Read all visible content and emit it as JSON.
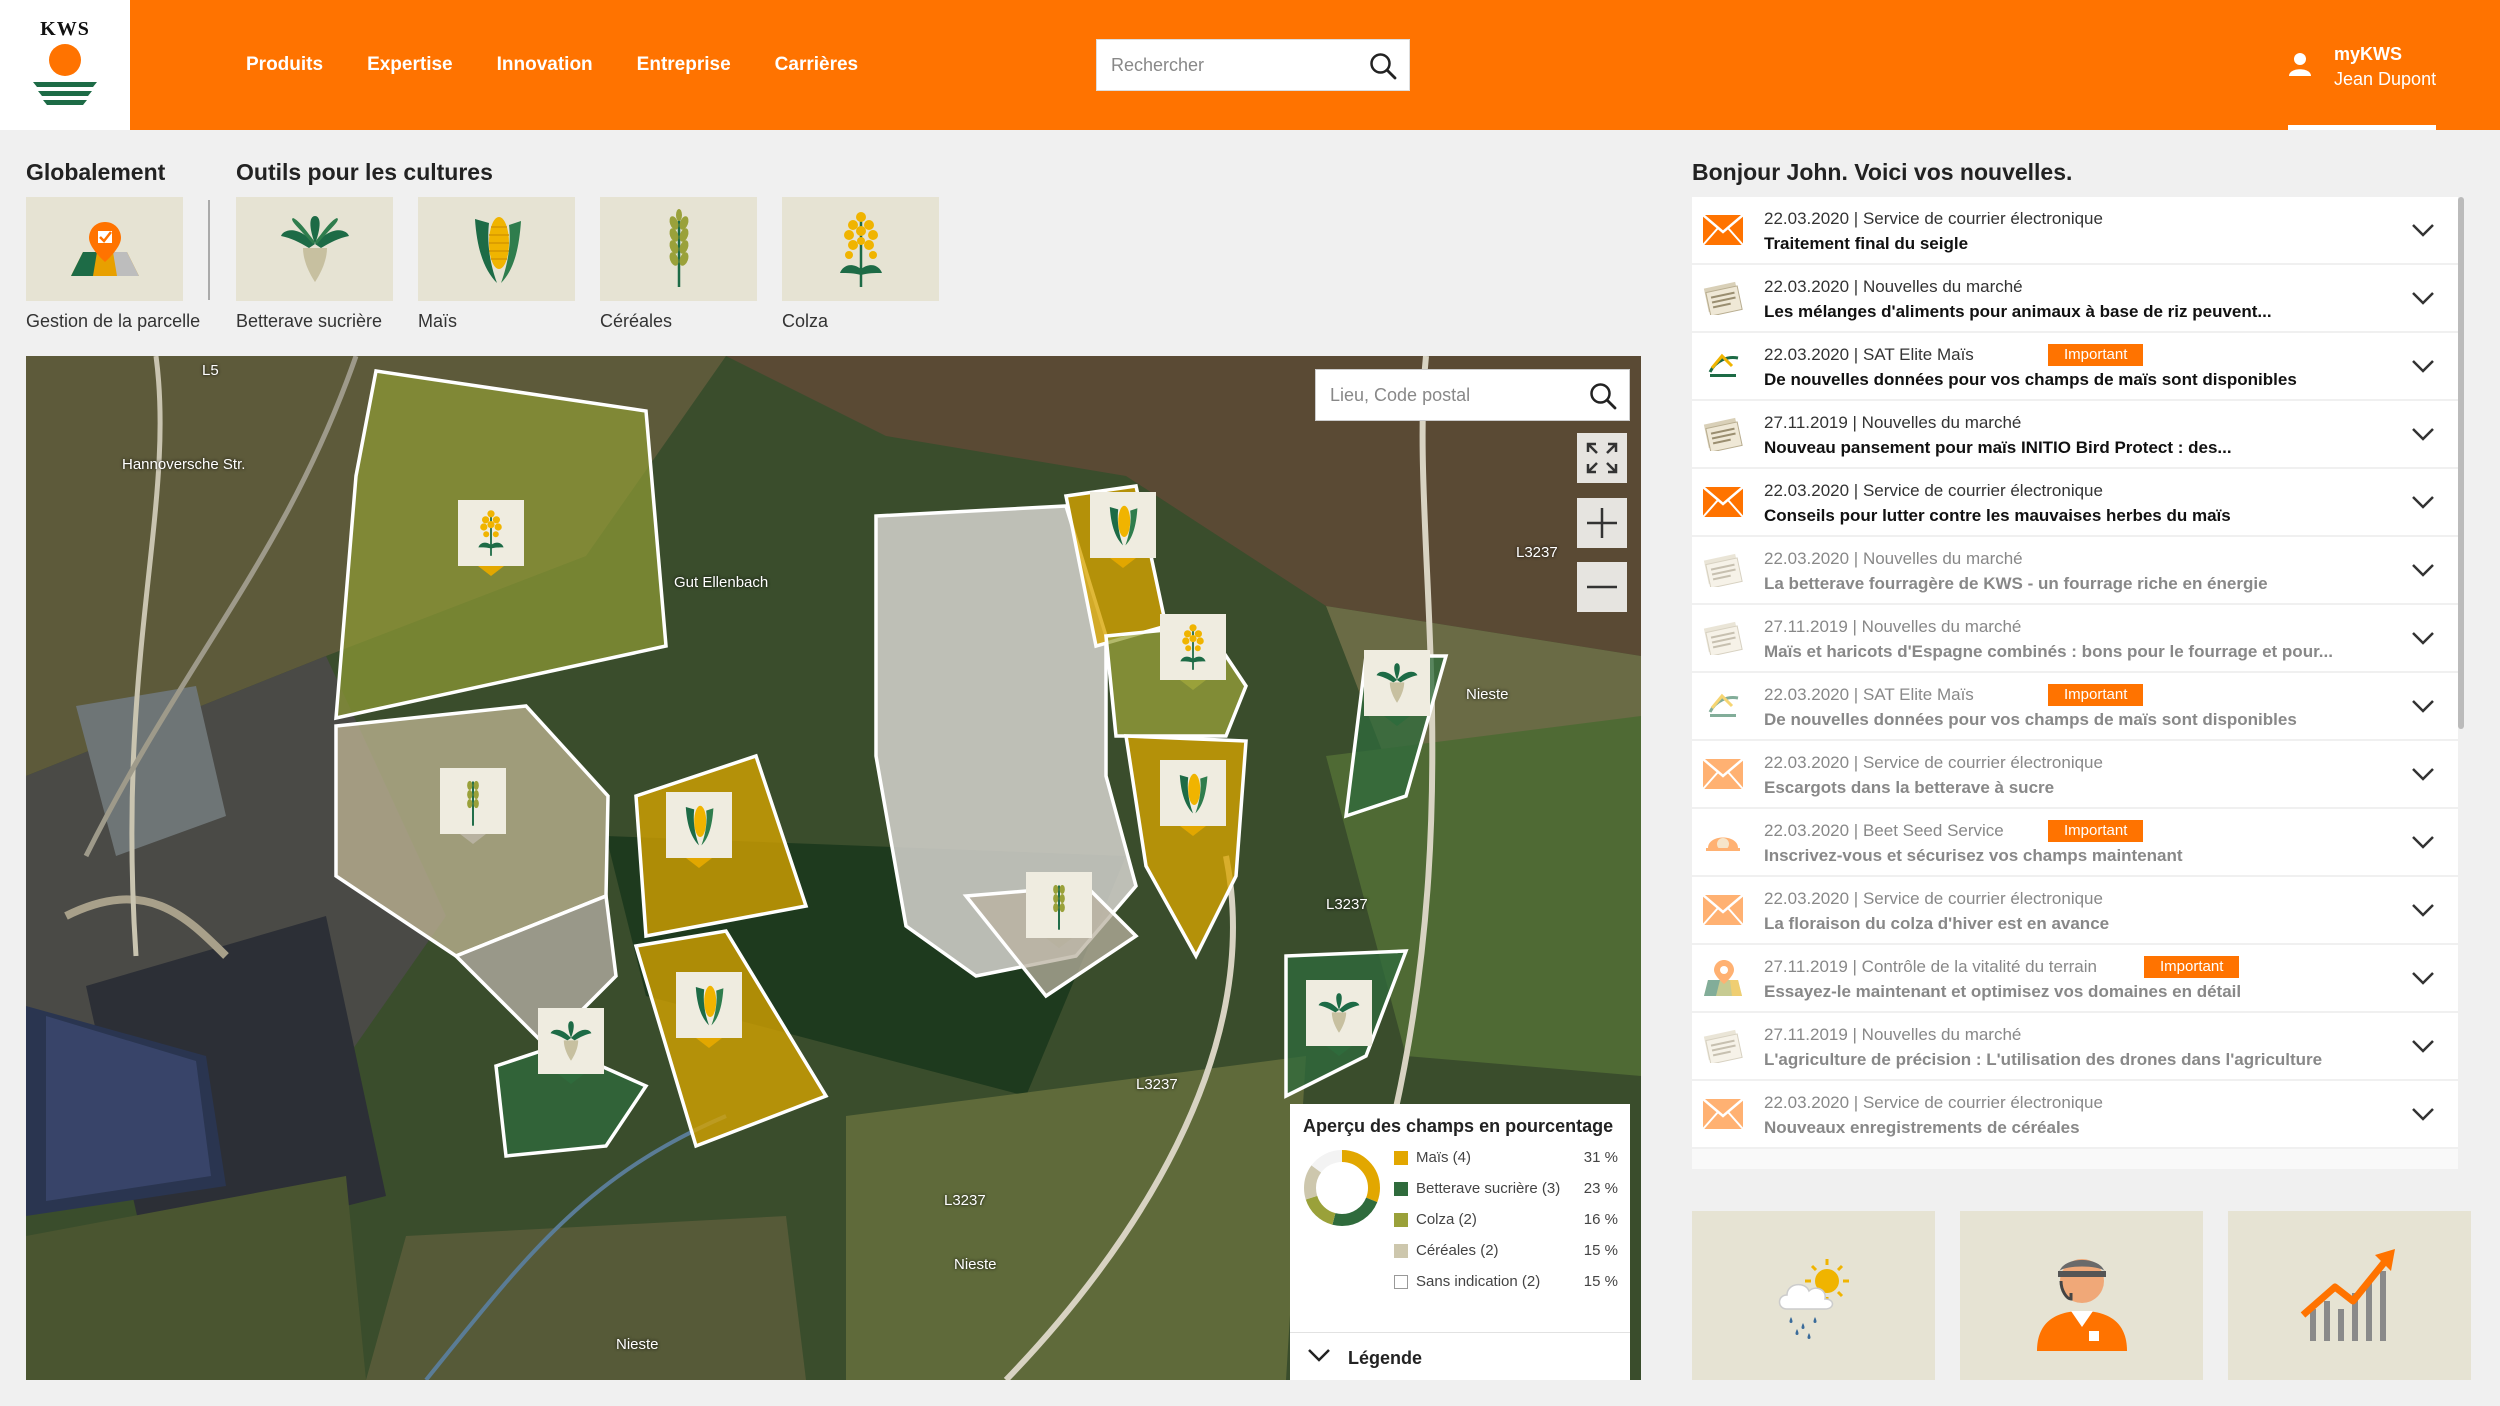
{
  "brand": {
    "logo_text": "KWS",
    "accent": "#ff7300"
  },
  "nav": {
    "items": [
      "Produits",
      "Expertise",
      "Innovation",
      "Entreprise",
      "Carrières"
    ]
  },
  "search": {
    "placeholder": "Rechercher",
    "icon": "search-icon"
  },
  "user": {
    "label": "myKWS",
    "name": "Jean Dupont",
    "icon": "user-icon"
  },
  "sections": {
    "overall": "Globalement",
    "crop_tools": "Outils pour les cultures",
    "news_greeting": "Bonjour John. Voici vos nouvelles."
  },
  "tools": [
    {
      "label": "Gestion de la parcelle",
      "icon": "field-map-pin-icon"
    },
    {
      "label": "Betterave sucrière",
      "icon": "sugar-beet-icon"
    },
    {
      "label": "Maïs",
      "icon": "corn-icon"
    },
    {
      "label": "Céréales",
      "icon": "wheat-icon"
    },
    {
      "label": "Colza",
      "icon": "rapeseed-icon"
    }
  ],
  "map": {
    "search_placeholder": "Lieu, Code postal",
    "place_label": "Gut Ellenbach",
    "road_labels": [
      "L3237",
      "L3237",
      "L3237",
      "L3237",
      "Nieste",
      "Nieste",
      "Nieste",
      "Hannoversche Str.",
      "L5"
    ],
    "controls": {
      "fullscreen": "fullscreen-icon",
      "zoom_in": "plus-icon",
      "zoom_out": "minus-icon"
    }
  },
  "legend": {
    "title": "Aperçu des champs en pourcentage",
    "items": [
      {
        "name": "Maïs (4)",
        "percent": "31 %",
        "color": "#e2a700",
        "share": 31
      },
      {
        "name": "Betterave sucrière (3)",
        "percent": "23 %",
        "color": "#2f6b3c",
        "share": 23
      },
      {
        "name": "Colza (2)",
        "percent": "16 %",
        "color": "#9aa13a",
        "share": 16
      },
      {
        "name": "Céréales (2)",
        "percent": "15 %",
        "color": "#cdc7ad",
        "share": 15
      },
      {
        "name": "Sans indication (2)",
        "percent": "15 %",
        "color": "#ffffff",
        "share": 15
      }
    ],
    "footer": "Légende"
  },
  "news": [
    {
      "meta": "22.03.2020 | Service de courrier électronique",
      "title": "Traitement final du seigle",
      "icon": "envelope-icon",
      "badge": "",
      "faded": false
    },
    {
      "meta": "22.03.2020 | Nouvelles du marché",
      "title": "Les mélanges d'aliments pour animaux à base de riz peuvent...",
      "icon": "newspaper-icon",
      "badge": "",
      "faded": false
    },
    {
      "meta": "22.03.2020 | SAT Elite Maïs",
      "title": "De nouvelles données pour vos champs de maïs sont disponibles",
      "icon": "sat-elite-icon",
      "badge": "Important",
      "faded": false
    },
    {
      "meta": "27.11.2019 | Nouvelles du marché",
      "title": "Nouveau pansement pour maïs INITIO Bird Protect : des...",
      "icon": "newspaper-icon",
      "badge": "",
      "faded": false
    },
    {
      "meta": "22.03.2020 | Service de courrier électronique",
      "title": "Conseils pour lutter contre les mauvaises herbes du maïs",
      "icon": "envelope-icon",
      "badge": "",
      "faded": false
    },
    {
      "meta": "22.03.2020 | Nouvelles du marché",
      "title": "La betterave fourragère de KWS - un fourrage riche en énergie",
      "icon": "newspaper-icon",
      "badge": "",
      "faded": true
    },
    {
      "meta": "27.11.2019 | Nouvelles du marché",
      "title": "Maïs et haricots d'Espagne combinés : bons pour le fourrage et pour...",
      "icon": "newspaper-icon",
      "badge": "",
      "faded": true
    },
    {
      "meta": "22.03.2020 | SAT Elite Maïs",
      "title": "De nouvelles données pour vos champs de maïs sont disponibles",
      "icon": "sat-elite-icon",
      "badge": "Important",
      "faded": true
    },
    {
      "meta": "22.03.2020 | Service de courrier électronique",
      "title": "Escargots dans la betterave à sucre",
      "icon": "envelope-icon",
      "badge": "",
      "faded": true
    },
    {
      "meta": "22.03.2020 | Beet Seed Service",
      "title": "Inscrivez-vous et sécurisez vos champs maintenant",
      "icon": "beet-seed-icon",
      "badge": "Important",
      "faded": true
    },
    {
      "meta": "22.03.2020 | Service de courrier électronique",
      "title": "La floraison du colza d'hiver est en avance",
      "icon": "envelope-icon",
      "badge": "",
      "faded": true
    },
    {
      "meta": "27.11.2019 | Contrôle de la vitalité du terrain",
      "title": "Essayez-le maintenant et optimisez vos domaines en détail",
      "icon": "vitality-icon",
      "badge": "Important",
      "faded": true
    },
    {
      "meta": "27.11.2019 | Nouvelles du marché",
      "title": "L'agriculture de précision : L'utilisation des drones dans l'agriculture",
      "icon": "newspaper-icon",
      "badge": "",
      "faded": true
    },
    {
      "meta": "22.03.2020 | Service de courrier électronique",
      "title": "Nouveaux enregistrements de céréales",
      "icon": "envelope-icon",
      "badge": "",
      "faded": true
    }
  ],
  "bottom_tiles": [
    {
      "icon": "weather-icon"
    },
    {
      "icon": "advisor-icon"
    },
    {
      "icon": "market-chart-icon"
    }
  ]
}
